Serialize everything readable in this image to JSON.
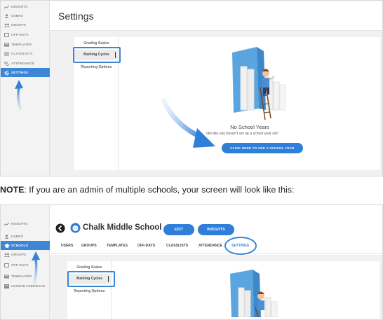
{
  "panel1": {
    "sidebar": {
      "items": [
        {
          "label": "INSIGHTS",
          "icon": "insights-icon"
        },
        {
          "label": "USERS",
          "icon": "user-icon"
        },
        {
          "label": "GROUPS",
          "icon": "groups-icon"
        },
        {
          "label": "OFF-DAYS",
          "icon": "calendar-icon"
        },
        {
          "label": "TEMPLATES",
          "icon": "templates-icon"
        },
        {
          "label": "CLASSLISTS",
          "icon": "classlists-icon"
        },
        {
          "label": "ATTENDANCE",
          "icon": "attendance-icon"
        },
        {
          "label": "SETTINGS",
          "icon": "gear-icon",
          "active": true
        }
      ]
    },
    "page_title": "Settings",
    "settings_nav": [
      "Grading Scales",
      "Marking Cycles",
      "Reporting Options"
    ],
    "selected_nav": "Marking Cycles",
    "empty_state": {
      "title": "No School Years",
      "subtitle": "oks like you haven't set up a school year yet!",
      "button": "CLICK HERE TO ADD A SCHOOL YEAR"
    }
  },
  "note": {
    "bold": "NOTE",
    "text": ": If you are an admin of multiple schools, your screen will look like this:"
  },
  "panel2": {
    "sidebar": {
      "items": [
        {
          "label": "INSIGHTS",
          "icon": "insights-icon"
        },
        {
          "label": "USERS",
          "icon": "user-icon"
        },
        {
          "label": "SCHOOLS",
          "icon": "school-icon",
          "active": true
        },
        {
          "label": "GROUPS",
          "icon": "groups-icon"
        },
        {
          "label": "OFF-DAYS",
          "icon": "calendar-icon"
        },
        {
          "label": "TEMPLATES",
          "icon": "templates-icon"
        },
        {
          "label": "LESSON FEEDBACK",
          "icon": "feedback-icon"
        }
      ]
    },
    "school_name": "Chalk Middle School",
    "buttons": {
      "edit": "EDIT",
      "insights": "INSIGHTS"
    },
    "tabs": [
      "USERS",
      "GROUPS",
      "TEMPLATES",
      "OFF-DAYS",
      "CLASSLISTS",
      "ATTENDANCE",
      "SETTINGS"
    ],
    "active_tab": "SETTINGS",
    "settings_nav": [
      "Grading Scales",
      "Marking Cycles",
      "Reporting Options"
    ]
  },
  "colors": {
    "accent": "#2f7ed8",
    "highlight": "#3b86d6",
    "sidebar_bg": "#f3f3f3"
  }
}
